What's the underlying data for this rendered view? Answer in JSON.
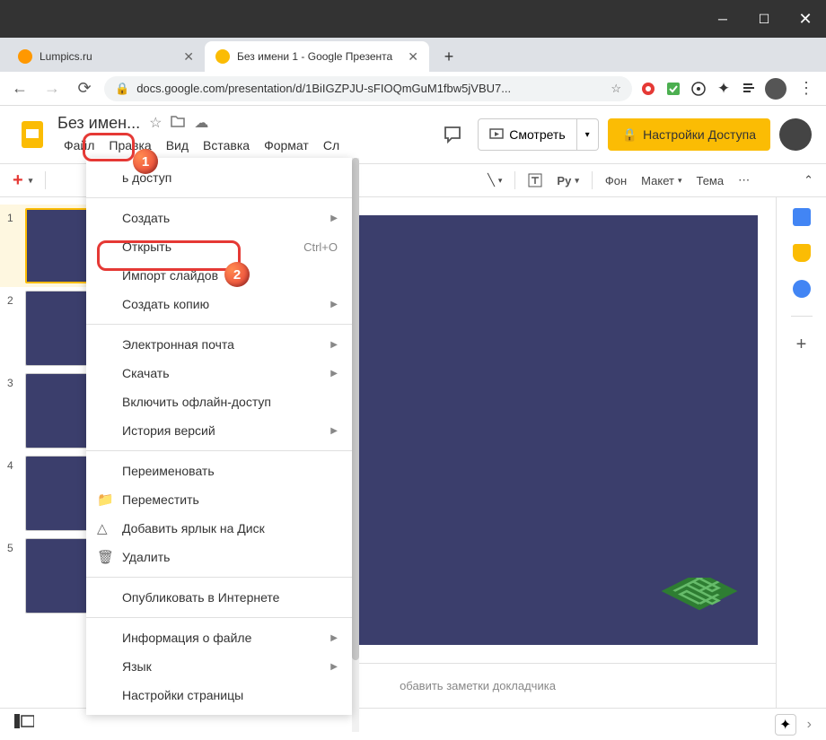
{
  "browser": {
    "tabs": [
      {
        "title": "Lumpics.ru",
        "icon_color": "#ff9800"
      },
      {
        "title": "Без имени 1 - Google Презента",
        "icon_color": "#fbbc04"
      }
    ],
    "url": "docs.google.com/presentation/d/1BiIGZPJU-sFIOQmGuM1fbw5jVBU7..."
  },
  "app": {
    "doc_title": "Без имен...",
    "menubar": [
      "Файл",
      "Правка",
      "Вид",
      "Вставка",
      "Формат",
      "Сл"
    ],
    "present_label": "Смотреть",
    "share_label": "Настройки Доступа",
    "toolbar": {
      "bg": "Фон",
      "layout": "Макет",
      "theme": "Тема"
    },
    "notes_placeholder": "обавить заметки докладчика"
  },
  "dropdown": [
    {
      "type": "item",
      "label": "ь доступ",
      "icon": "",
      "partial": true
    },
    {
      "type": "sep"
    },
    {
      "type": "item",
      "label": "Создать",
      "arrow": true
    },
    {
      "type": "item",
      "label": "Открыть",
      "shortcut": "Ctrl+O"
    },
    {
      "type": "item",
      "label": "Импорт слайдов"
    },
    {
      "type": "item",
      "label": "Создать копию",
      "arrow": true
    },
    {
      "type": "sep"
    },
    {
      "type": "item",
      "label": "Электронная почта",
      "arrow": true
    },
    {
      "type": "item",
      "label": "Скачать",
      "arrow": true
    },
    {
      "type": "item",
      "label": "Включить офлайн-доступ"
    },
    {
      "type": "item",
      "label": "История версий",
      "arrow": true
    },
    {
      "type": "sep"
    },
    {
      "type": "item",
      "label": "Переименовать"
    },
    {
      "type": "item",
      "label": "Переместить",
      "icon": "folder"
    },
    {
      "type": "item",
      "label": "Добавить ярлык на Диск",
      "icon": "drive"
    },
    {
      "type": "item",
      "label": "Удалить",
      "icon": "trash"
    },
    {
      "type": "sep"
    },
    {
      "type": "item",
      "label": "Опубликовать в Интернете"
    },
    {
      "type": "sep"
    },
    {
      "type": "item",
      "label": "Информация о файле",
      "arrow": true
    },
    {
      "type": "item",
      "label": "Язык",
      "arrow": true
    },
    {
      "type": "item",
      "label": "Настройки страницы",
      "partial": true
    }
  ],
  "slides": [
    1,
    2,
    3,
    4,
    5
  ],
  "badges": {
    "one": "1",
    "two": "2"
  }
}
